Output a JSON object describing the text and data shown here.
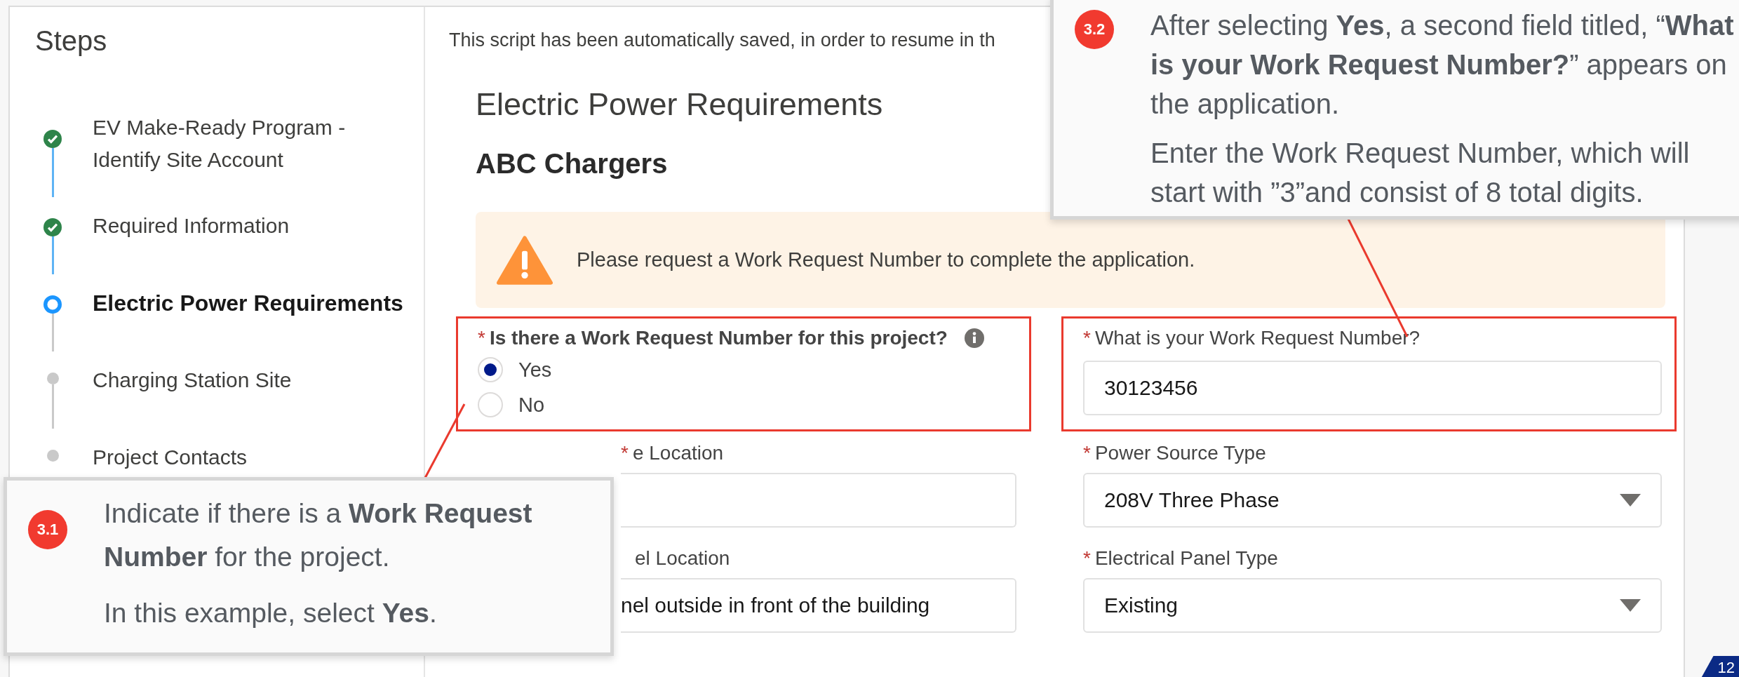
{
  "steps_panel": {
    "title": "Steps",
    "steps": [
      {
        "label": "EV Make-Ready Program - Identify Site Account",
        "completed": true,
        "selected": false
      },
      {
        "label": "Required Information",
        "completed": true,
        "selected": false
      },
      {
        "label": "Electric Power Requirements",
        "completed": false,
        "selected": true
      },
      {
        "label": "Charging Station Site",
        "completed": false,
        "selected": false
      },
      {
        "label": "Project Contacts",
        "completed": false,
        "selected": false
      }
    ]
  },
  "autosave_notice": "This script has been automatically saved, in order to resume in th",
  "form": {
    "title": "Electric Power Requirements",
    "subtitle": "ABC Chargers",
    "alert": "Please request a Work Request Number to complete the application.",
    "fields": [
      {
        "kind": "radio",
        "label": "Is there a Work Request Number for this project?",
        "required_mark": "*",
        "info_icon": true,
        "highlighted": true,
        "options": [
          {
            "label": "Yes",
            "selected": true
          },
          {
            "label": "No",
            "selected": false
          }
        ]
      },
      {
        "kind": "text",
        "label": "What is your Work Request Number?",
        "required_mark": "*",
        "highlighted": true,
        "value": "30123456"
      },
      {
        "kind": "text",
        "label": "e Location",
        "required_mark": "*",
        "highlighted": false
      },
      {
        "kind": "select",
        "label": "Power Source Type",
        "required_mark": "*",
        "highlighted": false,
        "value": "208V Three Phase"
      },
      {
        "kind": "text",
        "label": "el Location",
        "highlighted": false,
        "value": "nel outside in front of the building"
      },
      {
        "kind": "select",
        "label": "Electrical Panel Type",
        "required_mark": "*",
        "highlighted": false,
        "value": "Existing"
      }
    ]
  },
  "callouts": [
    {
      "badge": "3.1",
      "paragraphs": [
        "Indicate if there is a **Work Request Number** for the project.",
        "In this example, select **Yes**."
      ]
    },
    {
      "badge": "3.2",
      "paragraphs": [
        "After selecting **Yes**, a second field titled, “**What is your Work Request Number?**” appears on the application.",
        "Enter the Work Request Number, which will start with ”3”and consist of 8 total digits."
      ]
    }
  ],
  "page_number": "12"
}
